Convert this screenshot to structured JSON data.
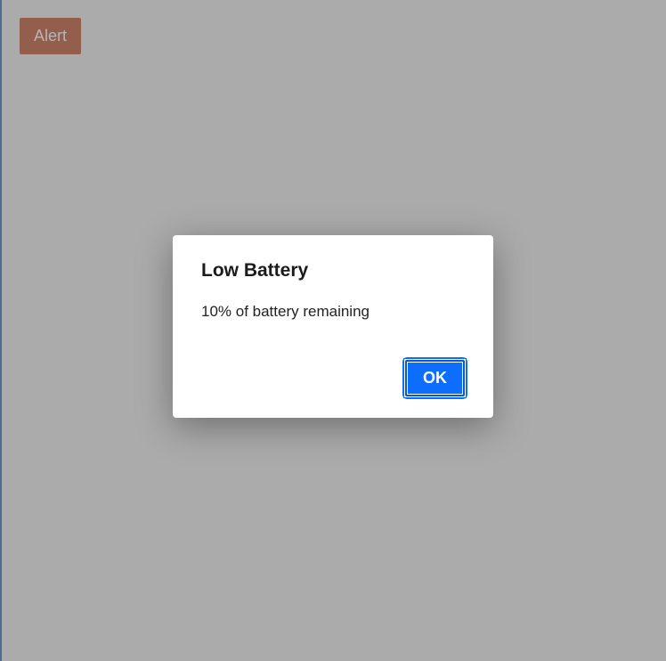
{
  "trigger": {
    "label": "Alert"
  },
  "dialog": {
    "title": "Low Battery",
    "message": "10% of battery remaining",
    "ok_label": "OK"
  }
}
